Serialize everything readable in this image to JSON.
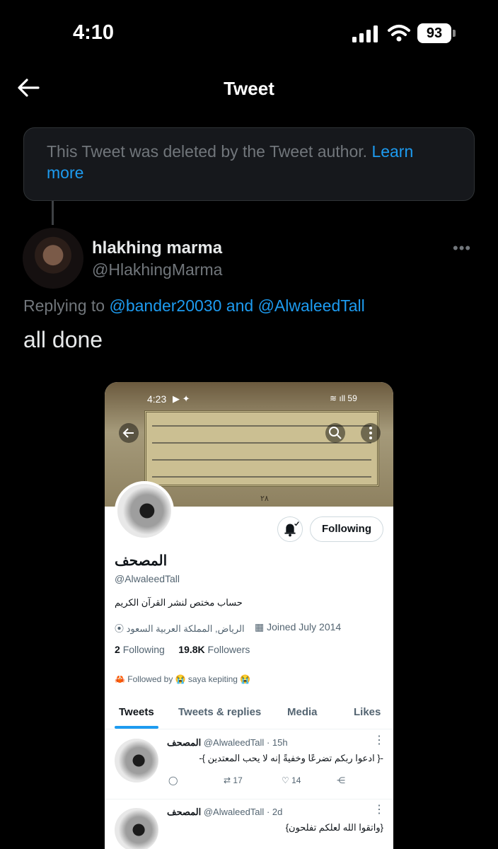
{
  "status_bar": {
    "time": "4:10",
    "battery": "93"
  },
  "nav": {
    "title": "Tweet"
  },
  "deleted_notice": {
    "text": "This Tweet was deleted by the Tweet author.",
    "link": "Learn more"
  },
  "tweet": {
    "author_name": "hlakhing marma",
    "author_handle": "@HlakhingMarma",
    "replying_prefix": "Replying to",
    "mention_1": "@bander20030",
    "and": "and",
    "mention_2": "@AlwaleedTall",
    "text": "all done"
  },
  "screenshot": {
    "status_time": "4:23",
    "battery": "59",
    "page_number": "٢٨",
    "profile": {
      "name": "المصحف",
      "handle": "@AlwaleedTall",
      "bio": "حساب مختص لنشر القرآن الكريم",
      "location": "الرياض, المملكة العربية السعود",
      "joined": "Joined July 2014",
      "following_count": "2",
      "following_label": "Following",
      "followers_count": "19.8K",
      "followers_label": "Followers",
      "followed_by": "Followed by 😭 saya kepiting 😭",
      "follow_button": "Following"
    },
    "tabs": [
      "Tweets",
      "Tweets & replies",
      "Media",
      "Likes"
    ],
    "tweets": [
      {
        "name": "المصحف",
        "handle": "@AlwaleedTall",
        "time": "· 15h",
        "text": "-{ ادعوا ربكم تضرعًا وخفيةً إنه لا يحب المعتدين }-",
        "retweets": "17",
        "likes": "14"
      },
      {
        "name": "المصحف",
        "handle": "@AlwaleedTall",
        "time": "· 2d",
        "text": "{واتقوا الله لعلكم تفلحون}",
        "retweets": "",
        "likes": ""
      }
    ]
  }
}
